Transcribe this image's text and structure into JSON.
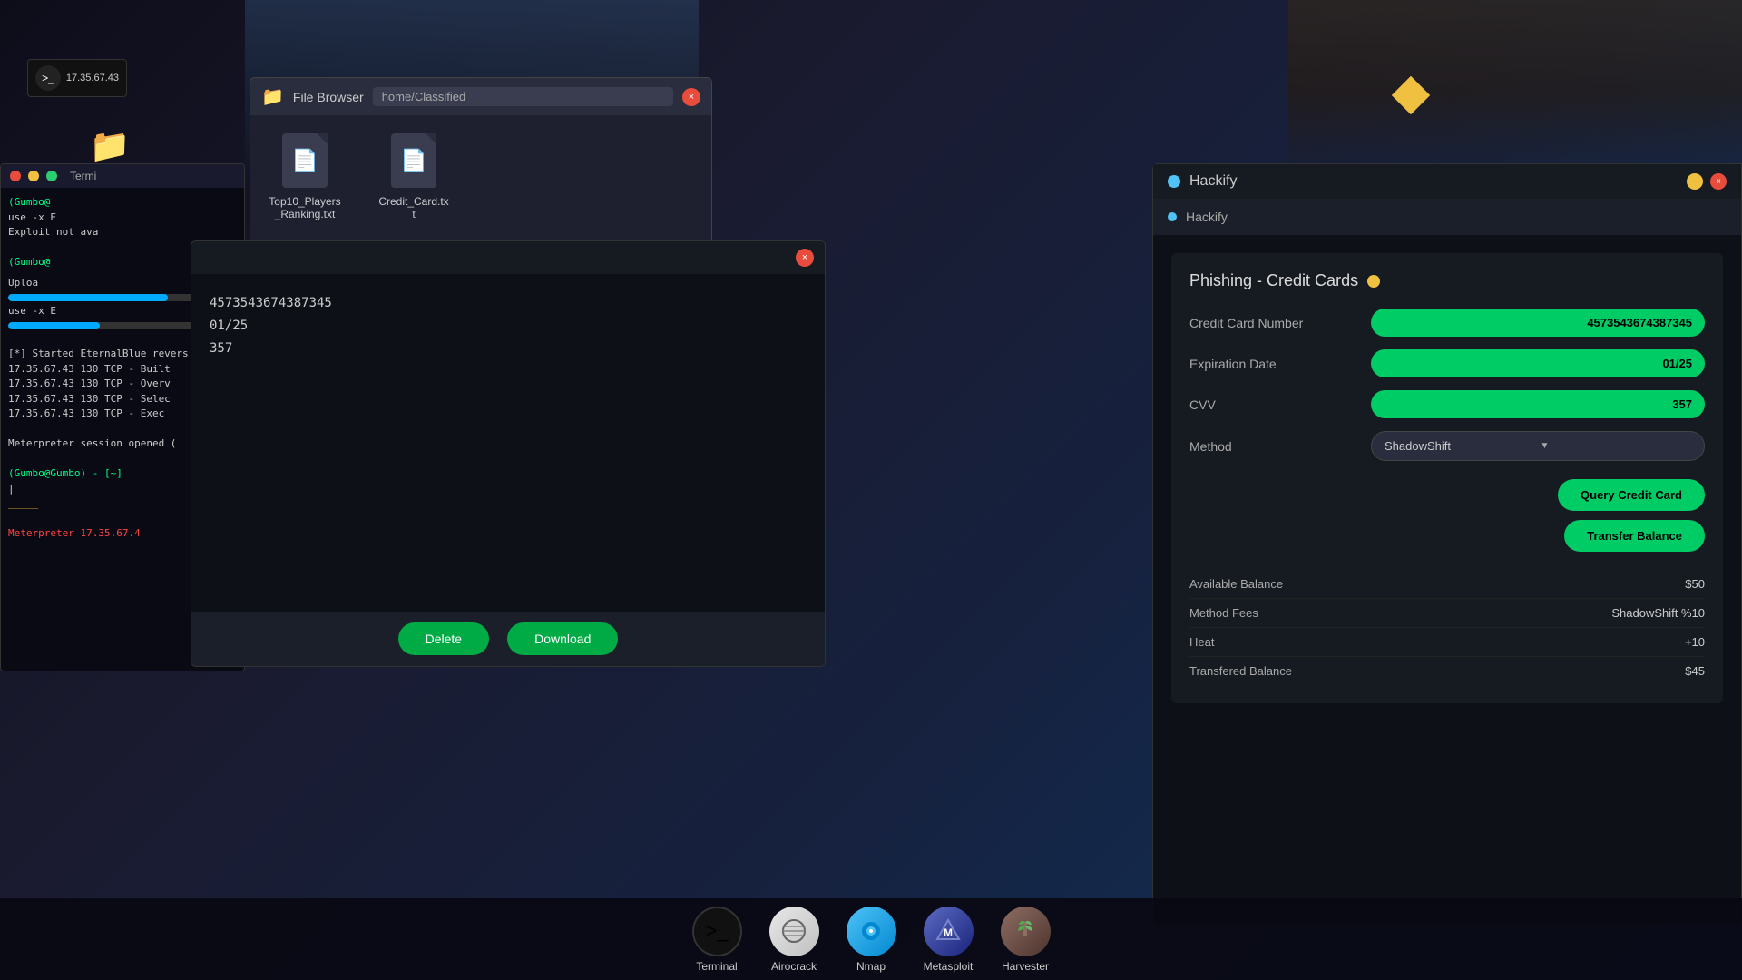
{
  "desktop": {
    "bg_color": "#0d0d1a"
  },
  "terminal_small": {
    "ip": "17.35.67.43",
    "label": "Termi"
  },
  "terminal2": {
    "label": "Termi"
  },
  "folder": {
    "label": "Classified"
  },
  "file_browser": {
    "title": "File Browser",
    "path": "home/Classified",
    "close_label": "×",
    "files": [
      {
        "name": "Top10_Players_Ranking.txt"
      },
      {
        "name": "Credit_Card.txt"
      }
    ]
  },
  "terminal_main": {
    "lines": [
      "(Gumbo@",
      "use -x E",
      "Exploit not ava",
      "(Gumbo@",
      "use -x E",
      "[*] Started EternalBlue revers",
      "17.35.67.43 130 TCP  - Built",
      "17.35.67.43 130 TCP  - Overv",
      "17.35.67.43 130 TCP  - Selec",
      "17.35.67.43 130 TCP  - Exec",
      "Meterpreter session opened (",
      "(Gumbo@Gumbo) - [~]",
      "Meterpreter 17.35.67.4"
    ],
    "upload_label": "Uploa"
  },
  "file_viewer": {
    "close_label": "×",
    "content_lines": [
      "4573543674387345",
      "01/25",
      "357"
    ],
    "delete_button": "Delete",
    "download_button": "Download"
  },
  "hackify": {
    "window_title": "Hackify",
    "nav_label": "Hackify",
    "min_label": "−",
    "close_label": "×",
    "section_title": "Phishing - Credit Cards",
    "fields": {
      "credit_card_label": "Credit Card Number",
      "credit_card_value": "4573543674387345",
      "expiration_label": "Expiration Date",
      "expiration_value": "01/25",
      "cvv_label": "CVV",
      "cvv_value": "357",
      "method_label": "Method",
      "method_value": "ShadowShift"
    },
    "buttons": {
      "query": "Query Credit Card",
      "transfer": "Transfer Balance"
    },
    "info": {
      "available_balance_label": "Available Balance",
      "available_balance_value": "$50",
      "method_fees_label": "Method Fees",
      "method_fees_value": "ShadowShift %10",
      "heat_label": "Heat",
      "heat_value": "+10",
      "transferred_balance_label": "Transfered Balance",
      "transferred_balance_value": "$45"
    }
  },
  "taskbar": {
    "items": [
      {
        "id": "terminal",
        "label": "Terminal",
        "icon": ">_"
      },
      {
        "id": "airocrack",
        "label": "Airocrack",
        "icon": "⚡"
      },
      {
        "id": "nmap",
        "label": "Nmap",
        "icon": "👁"
      },
      {
        "id": "metasploit",
        "label": "Metasploit",
        "icon": "M"
      },
      {
        "id": "harvester",
        "label": "Harvester",
        "icon": "🌾"
      }
    ]
  }
}
